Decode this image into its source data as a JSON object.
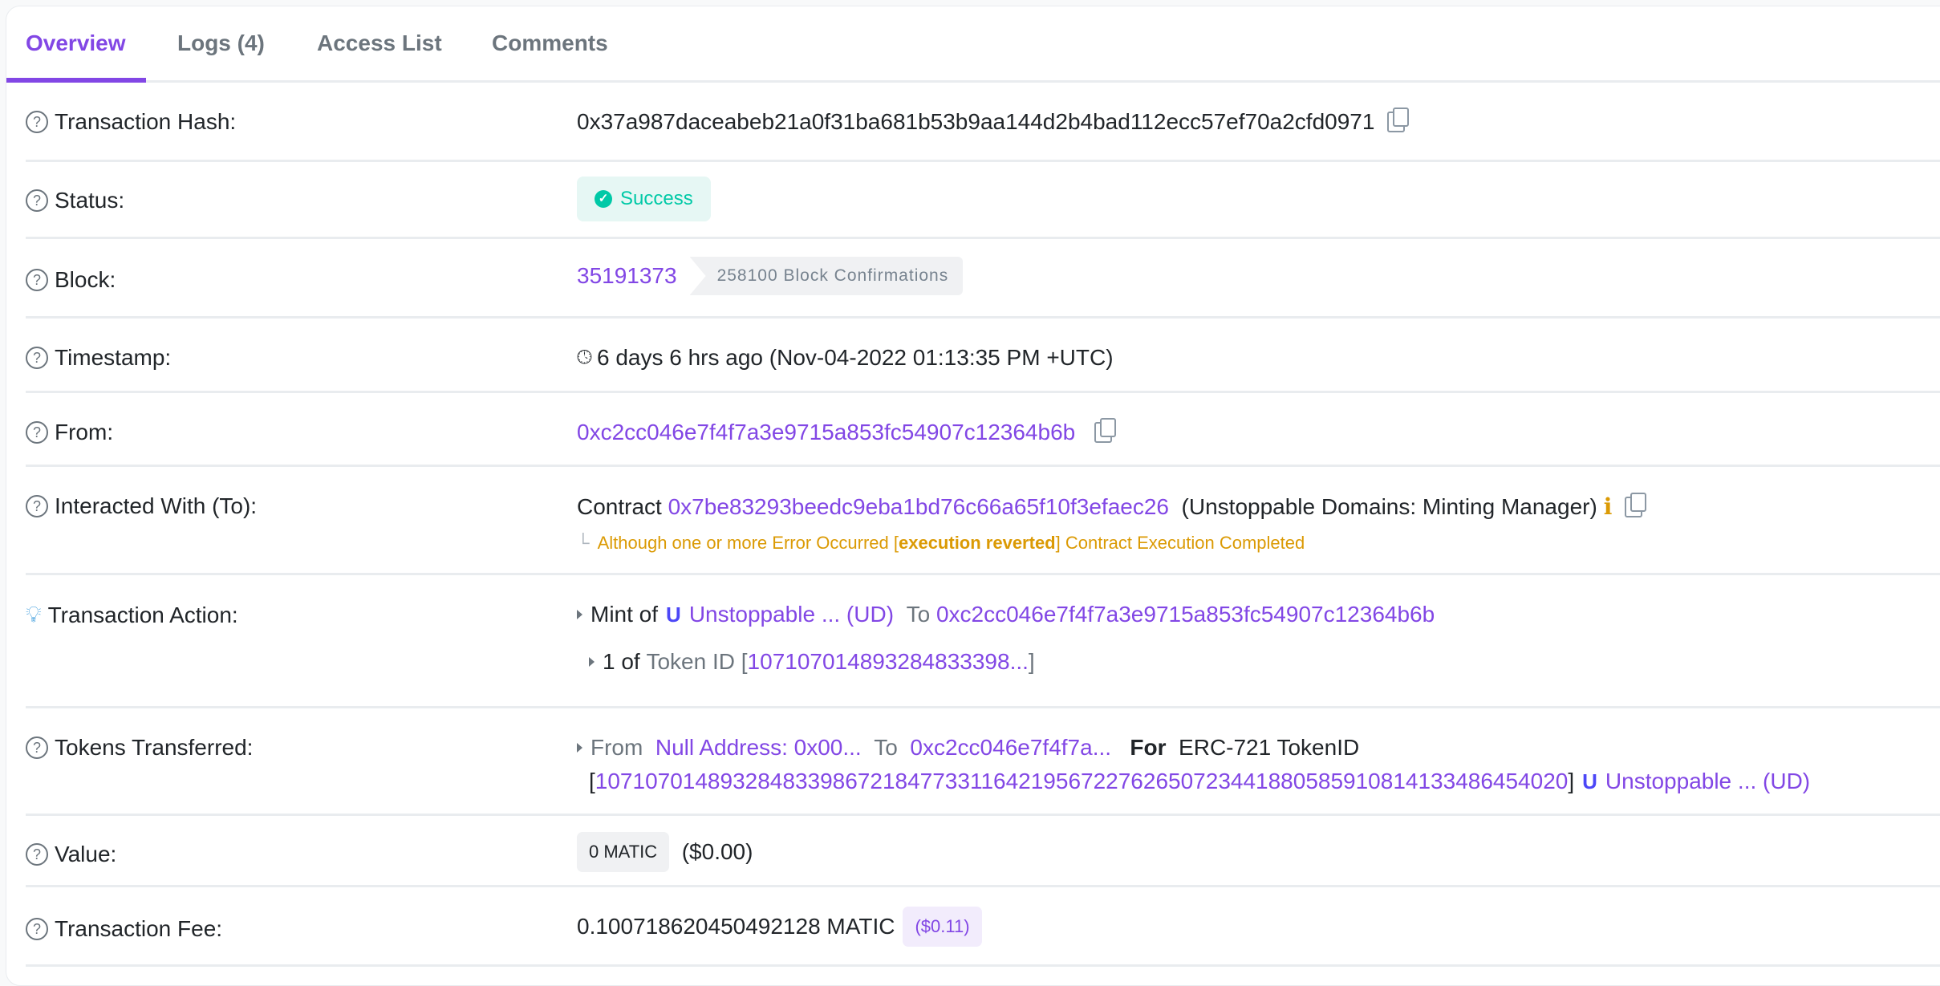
{
  "tabs": [
    {
      "label": "Overview",
      "active": true
    },
    {
      "label": "Logs (4)",
      "active": false
    },
    {
      "label": "Access List",
      "active": false
    },
    {
      "label": "Comments",
      "active": false
    }
  ],
  "rows": {
    "hash": {
      "label": "Transaction Hash:",
      "value": "0x37a987daceabeb21a0f31ba681b53b9aa144d2b4bad112ecc57ef70a2cfd0971"
    },
    "status": {
      "label": "Status:",
      "value": "Success"
    },
    "block": {
      "label": "Block:",
      "number": "35191373",
      "confirmations": "258100 Block Confirmations"
    },
    "timestamp": {
      "label": "Timestamp:",
      "value": "6 days 6 hrs ago (Nov-04-2022 01:13:35 PM +UTC)"
    },
    "from": {
      "label": "From:",
      "value": "0xc2cc046e7f4f7a3e9715a853fc54907c12364b6b"
    },
    "to": {
      "label": "Interacted With (To):",
      "prefix": "Contract",
      "address": "0x7be83293beedc9eba1bd76c66a65f10f3efaec26",
      "name": "(Unstoppable Domains: Minting Manager)",
      "warning_pre": "Although one or more Error Occurred [",
      "warning_bold": "execution reverted",
      "warning_post": "] Contract Execution Completed"
    },
    "action": {
      "label": "Transaction Action:",
      "mint_of": "Mint of",
      "token_name": "Unstoppable ... (UD)",
      "to_label": "To",
      "to_address": "0xc2cc046e7f4f7a3e9715a853fc54907c12364b6b",
      "count": "1 of",
      "token_id_label": "Token ID",
      "token_id": "107107014893284833398..."
    },
    "tokens": {
      "label": "Tokens Transferred:",
      "from_label": "From",
      "from_value": "Null Address: 0x00...",
      "to_label": "To",
      "to_value": "0xc2cc046e7f4f7a...",
      "for_label": "For",
      "standard": "ERC-721 TokenID",
      "token_id": "107107014893284833986721847733116421956722762650723441880585910814133486454020",
      "token_name": "Unstoppable ... (UD)"
    },
    "value": {
      "label": "Value:",
      "amount": "0 MATIC",
      "usd": "($0.00)"
    },
    "fee": {
      "label": "Transaction Fee:",
      "amount": "0.100718620450492128 MATIC",
      "usd": "($0.11)"
    }
  },
  "colors": {
    "accent": "#8247e5",
    "success": "#00c9a7",
    "warning": "#db9a04"
  }
}
